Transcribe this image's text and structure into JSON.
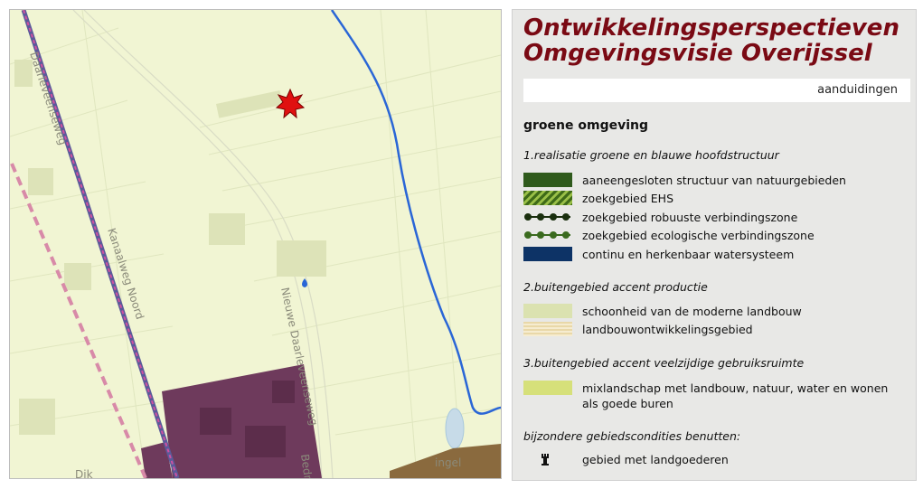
{
  "map": {
    "road_labels": [
      "Daarleveenseweg",
      "Kanaalweg Noord",
      "Nieuwe Daarleveenseweg",
      "Bedr",
      "Dik",
      "ingel"
    ]
  },
  "legend": {
    "title_line1": "Ontwikkelingsperspectieven",
    "title_line2": "Omgevingsvisie Overijssel",
    "dropdown_value": "aanduidingen",
    "section_heading": "groene omgeving",
    "groups": [
      {
        "title": "1.realisatie groene en blauwe hoofdstructuur",
        "items": [
          {
            "label": "aaneengesloten structuur van natuurgebieden",
            "color": "#2f5a1c",
            "style": "solid"
          },
          {
            "label": "zoekgebied EHS",
            "color": "#3f6b18",
            "style": "hatch"
          },
          {
            "label": "zoekgebied robuuste verbindingszone",
            "color": "#1a2f0e",
            "style": "dots"
          },
          {
            "label": "zoekgebied ecologische verbindingszone",
            "color": "#3a6a1e",
            "style": "dots"
          },
          {
            "label": "continu en herkenbaar watersysteem",
            "color": "#0d3366",
            "style": "solid"
          }
        ]
      },
      {
        "title": "2.buitengebied accent productie",
        "items": [
          {
            "label": "schoonheid van de moderne landbouw",
            "color": "#dbe2b0",
            "style": "solid"
          },
          {
            "label": "landbouwontwikkelingsgebied",
            "color": "#e9d8a8",
            "style": "stripes"
          }
        ]
      },
      {
        "title": "3.buitengebied accent veelzijdige gebruiksruimte",
        "items": [
          {
            "label": "mixlandschap met landbouw, natuur, water en wonen",
            "label2": "als goede buren",
            "color": "#d6e07a",
            "style": "solid"
          }
        ]
      }
    ],
    "special_title": "bijzondere gebiedscondities benutten:",
    "special_item": "gebied met landgoederen"
  }
}
